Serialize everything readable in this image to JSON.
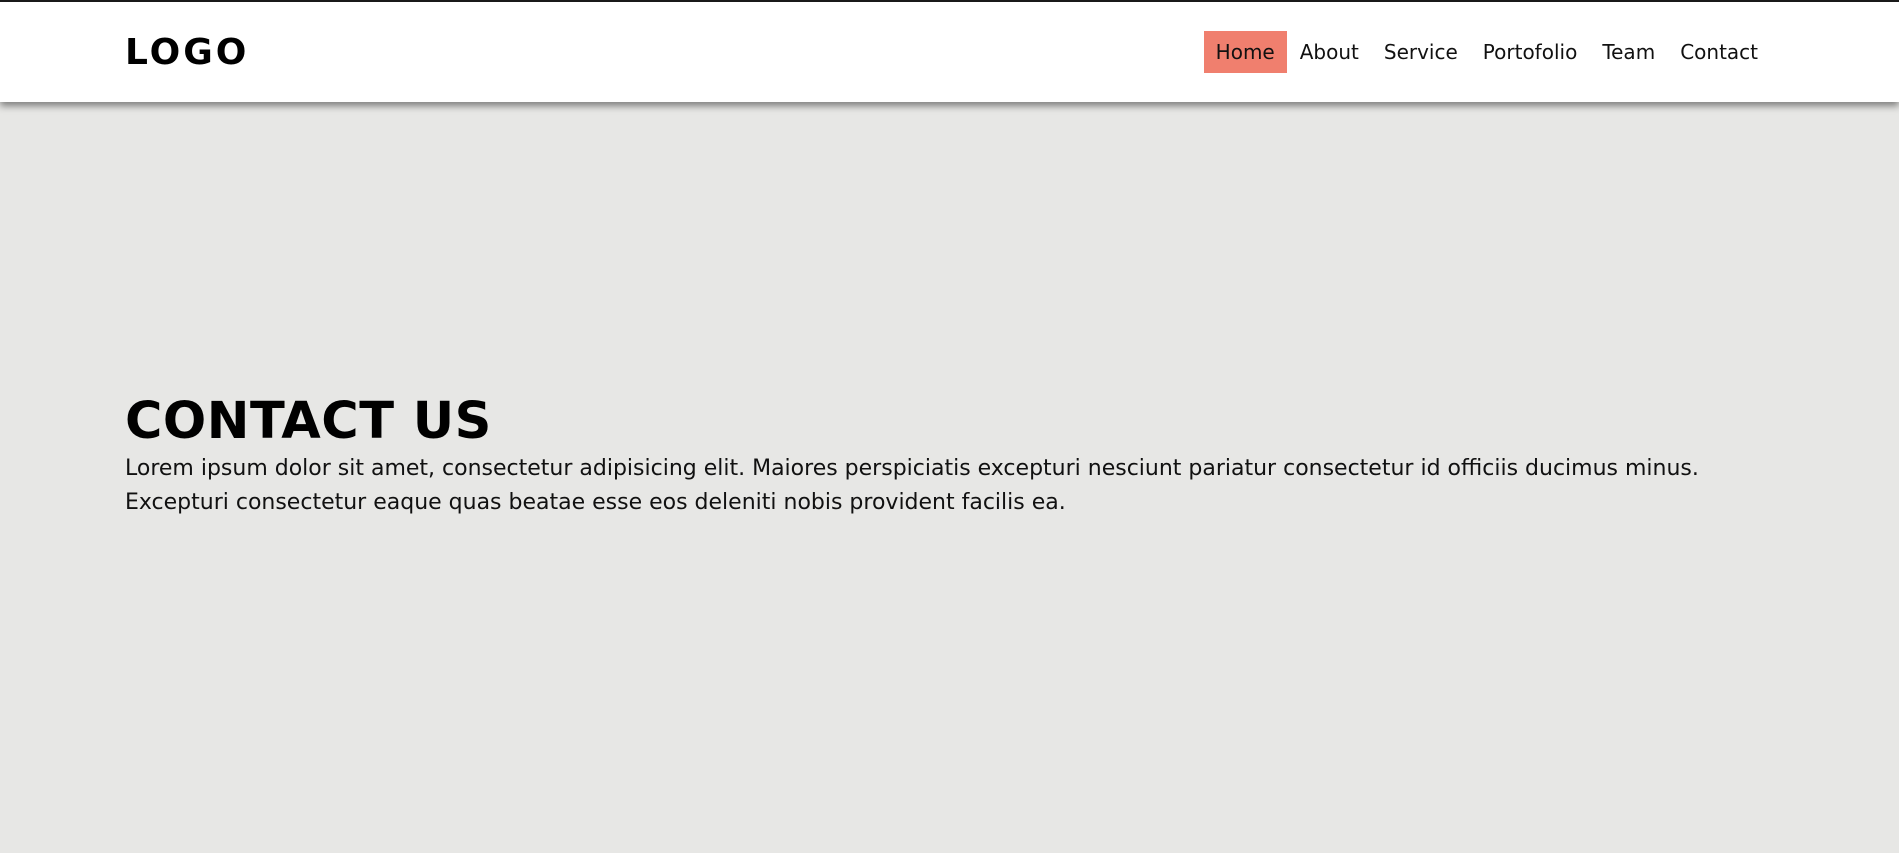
{
  "brand": {
    "logo_text": "LOGO"
  },
  "nav": {
    "items": [
      {
        "label": "Home",
        "active": true
      },
      {
        "label": "About",
        "active": false
      },
      {
        "label": "Service",
        "active": false
      },
      {
        "label": "Portofolio",
        "active": false
      },
      {
        "label": "Team",
        "active": false
      },
      {
        "label": "Contact",
        "active": false
      }
    ]
  },
  "hero": {
    "title": "CONTACT US",
    "text": "Lorem ipsum dolor sit amet, consectetur adipisicing elit. Maiores perspiciatis excepturi nesciunt pariatur consectetur id officiis ducimus minus. Excepturi consectetur eaque quas beatae esse eos deleniti nobis provident facilis ea."
  },
  "colors": {
    "page_background": "#e7e7e5",
    "header_background": "#ffffff",
    "active_nav_background": "#f07f6e",
    "text": "#000000"
  }
}
